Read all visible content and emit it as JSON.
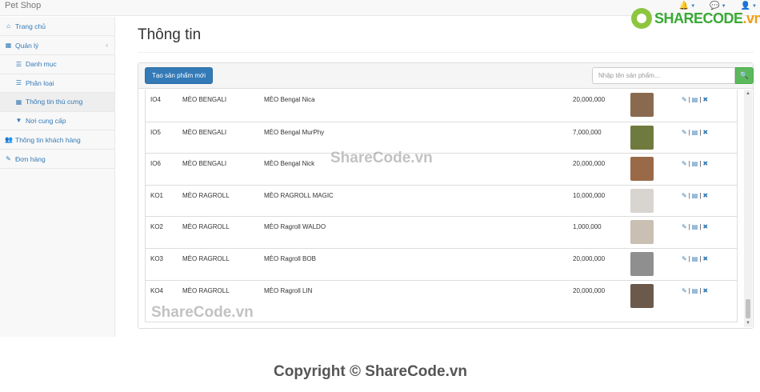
{
  "app": {
    "title": "Pet Shop"
  },
  "navbar": {
    "icons": [
      {
        "name": "bell-icon",
        "glyph": "🔔"
      },
      {
        "name": "comment-icon",
        "glyph": "💬"
      },
      {
        "name": "user-icon",
        "glyph": "👤"
      }
    ]
  },
  "logo": {
    "part1": "SHARECODE",
    "part2": ".vn"
  },
  "sidebar": {
    "items": [
      {
        "icon": "home-icon",
        "glyph": "⌂",
        "label": "Trang chủ"
      },
      {
        "icon": "table-icon",
        "glyph": "▦",
        "label": "Quản lý",
        "arrow": "‹"
      },
      {
        "icon": "list-icon",
        "glyph": "☰",
        "label": "Danh mục",
        "sub": true
      },
      {
        "icon": "list-icon",
        "glyph": "☰",
        "label": "Phân loại",
        "sub": true
      },
      {
        "icon": "grid-icon",
        "glyph": "▦",
        "label": "Thông tin thú cưng",
        "sub": true,
        "active": true
      },
      {
        "icon": "filter-icon",
        "glyph": "▼",
        "label": "Nơi cung cấp",
        "sub": true
      },
      {
        "icon": "users-icon",
        "glyph": "👥",
        "label": "Thông tin khách hàng"
      },
      {
        "icon": "edit-icon",
        "glyph": "✎",
        "label": "Đơn hàng"
      }
    ]
  },
  "main": {
    "title": "Thông tin",
    "create_button": "Tạo sản phẩm mới",
    "search": {
      "placeholder": "Nhập tên sản phẩm...",
      "value": ""
    }
  },
  "table": {
    "rows": [
      {
        "id": "IO4",
        "category": "MÈO BENGALI",
        "name": "MÈO Bengal Nica",
        "price": "20,000,000",
        "thumb": "#8a6a4f"
      },
      {
        "id": "IO5",
        "category": "MÈO BENGALI",
        "name": "MÈO Bengal MurPhy",
        "price": "7,000,000",
        "thumb": "#6f7a3e"
      },
      {
        "id": "IO6",
        "category": "MÈO BENGALI",
        "name": "MÈO Bengal Nick",
        "price": "20,000,000",
        "thumb": "#9a6a48"
      },
      {
        "id": "KO1",
        "category": "MÈO RAGROLL",
        "name": "MÈO RAGROLL MAGIC",
        "price": "10,000,000",
        "thumb": "#d8d4cf"
      },
      {
        "id": "KO2",
        "category": "MÈO RAGROLL",
        "name": "MÈO Ragroll WALDO",
        "price": "1,000,000",
        "thumb": "#c9bfb2"
      },
      {
        "id": "KO3",
        "category": "MÈO RAGROLL",
        "name": "MÈO Ragroll BOB",
        "price": "20,000,000",
        "thumb": "#8f8f8f"
      },
      {
        "id": "KO4",
        "category": "MÈO RAGROLL",
        "name": "MÈO Ragroll LIN",
        "price": "20,000,000",
        "thumb": "#6b5a4c"
      }
    ],
    "actions": {
      "edit": "✎",
      "sep": "|",
      "detail": "▤",
      "delete": "✖"
    }
  },
  "watermarks": {
    "center": "ShareCode.vn",
    "lower": "ShareCode.vn",
    "copyright": "Copyright © ShareCode.vn"
  }
}
